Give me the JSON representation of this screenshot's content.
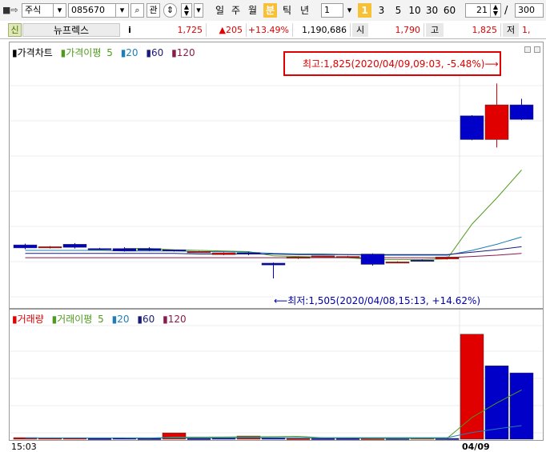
{
  "toolbar": {
    "market": "주식",
    "code": "085670",
    "btn_gwan": "관",
    "periods": [
      "일",
      "주",
      "월",
      "분",
      "틱",
      "년"
    ],
    "active_period": "분",
    "interval_value": "1",
    "presets": [
      "1",
      "3",
      "5",
      "10",
      "30",
      "60"
    ],
    "count_value": "21",
    "slash": "/",
    "total_value": "300"
  },
  "quote": {
    "badge": "신",
    "name": "뉴프렉스",
    "info_btn": "i",
    "price": "1,725",
    "change": "▲205",
    "change_rate": "+13.49%",
    "volume": "1,190,686",
    "open_label": "시",
    "open": "1,790",
    "high_label": "고",
    "high": "1,825",
    "low_label": "저",
    "low_partial": "1,"
  },
  "price_pane": {
    "legend": {
      "title": "가격차트",
      "ma_label": "가격이평",
      "ma1": "5",
      "ma2": "20",
      "ma3": "60",
      "ma4": "120"
    },
    "high_annotation": "최고:1,825(2020/04/09,09:03, -5.48%)⟶",
    "low_annotation": "⟵최저:1,505(2020/04/08,15:13, +14.62%)"
  },
  "volume_pane": {
    "legend": {
      "title": "거래량",
      "ma_label": "거래이평",
      "ma1": "5",
      "ma2": "20",
      "ma3": "60",
      "ma4": "120"
    }
  },
  "xaxis": {
    "left_label": "15:03",
    "right_label": "04/09"
  },
  "colors": {
    "up": "#e00000",
    "down": "#0000c8",
    "ma5": "#4f9a1e",
    "ma20": "#1e7fb8",
    "ma60": "#1a1a7a",
    "ma120": "#8a1a4a",
    "active_tab": "#f7c137",
    "annotation_box": "#e00000"
  },
  "chart_data": [
    {
      "type": "candlestick",
      "title": "가격차트",
      "ylim": [
        1480,
        1840
      ],
      "candles": [
        {
          "o": 1560,
          "c": 1555,
          "h": 1562,
          "l": 1553
        },
        {
          "o": 1555,
          "c": 1557,
          "h": 1558,
          "l": 1554
        },
        {
          "o": 1561,
          "c": 1556,
          "h": 1563,
          "l": 1554
        },
        {
          "o": 1554,
          "c": 1553,
          "h": 1555,
          "l": 1552
        },
        {
          "o": 1554,
          "c": 1550,
          "h": 1556,
          "l": 1549
        },
        {
          "o": 1554,
          "c": 1551,
          "h": 1556,
          "l": 1550
        },
        {
          "o": 1552,
          "c": 1551,
          "h": 1552,
          "l": 1549
        },
        {
          "o": 1549,
          "c": 1549,
          "h": 1550,
          "l": 1548
        },
        {
          "o": 1544,
          "c": 1547,
          "h": 1548,
          "l": 1543
        },
        {
          "o": 1547,
          "c": 1545,
          "h": 1548,
          "l": 1543
        },
        {
          "o": 1530,
          "c": 1527,
          "h": 1531,
          "l": 1505
        },
        {
          "o": 1539,
          "c": 1540,
          "h": 1541,
          "l": 1537
        },
        {
          "o": 1541,
          "c": 1542,
          "h": 1542,
          "l": 1540
        },
        {
          "o": 1541,
          "c": 1541,
          "h": 1542,
          "l": 1540
        },
        {
          "o": 1545,
          "c": 1528,
          "h": 1546,
          "l": 1526
        },
        {
          "o": 1531,
          "c": 1532,
          "h": 1533,
          "l": 1530
        },
        {
          "o": 1535,
          "c": 1534,
          "h": 1536,
          "l": 1533
        },
        {
          "o": 1537,
          "c": 1540,
          "h": 1541,
          "l": 1536
        },
        {
          "o": 1772,
          "c": 1733,
          "h": 1773,
          "l": 1732
        },
        {
          "o": 1733,
          "c": 1790,
          "h": 1825,
          "l": 1720
        },
        {
          "o": 1790,
          "c": 1766,
          "h": 1800,
          "l": 1765
        }
      ],
      "ma5": [
        null,
        null,
        null,
        null,
        1554,
        1554,
        1552,
        1551,
        1550,
        1549,
        1542,
        1541,
        1540,
        1539,
        1536,
        1536,
        1536,
        1537,
        1594,
        1637,
        1683
      ],
      "ma20": [
        1551,
        1551,
        1551,
        1551,
        1550,
        1550,
        1550,
        1549,
        1549,
        1548,
        1546,
        1545,
        1545,
        1544,
        1543,
        1543,
        1543,
        1543,
        1551,
        1561,
        1573
      ],
      "ma60": [
        1546,
        1546,
        1546,
        1546,
        1546,
        1546,
        1546,
        1545,
        1545,
        1545,
        1545,
        1544,
        1544,
        1544,
        1544,
        1544,
        1544,
        1544,
        1548,
        1552,
        1557
      ],
      "ma120": [
        1539,
        1539,
        1539,
        1539,
        1539,
        1539,
        1539,
        1539,
        1539,
        1539,
        1539,
        1539,
        1539,
        1539,
        1539,
        1539,
        1539,
        1539,
        1541,
        1543,
        1546
      ]
    },
    {
      "type": "bar",
      "title": "거래량",
      "ylim": [
        0,
        150
      ],
      "values": [
        2,
        1.5,
        1.5,
        1,
        1.5,
        1,
        8,
        1,
        1.5,
        4,
        1.5,
        1,
        1,
        1,
        1,
        1,
        1.5,
        1,
        133,
        93,
        84
      ],
      "up": [
        true,
        true,
        true,
        false,
        false,
        false,
        true,
        false,
        false,
        true,
        false,
        true,
        false,
        false,
        true,
        false,
        true,
        false,
        true,
        false,
        false
      ],
      "ma5": [
        null,
        null,
        null,
        null,
        1.5,
        1.3,
        2.6,
        2.6,
        2.8,
        3.1,
        3.2,
        3.6,
        1.8,
        1.7,
        1.1,
        1,
        1.1,
        1.1,
        27.5,
        45.9,
        62.4
      ],
      "ma20": [
        1.7,
        1.7,
        1.7,
        1.7,
        1.7,
        1.7,
        1.8,
        1.8,
        1.8,
        1.9,
        1.9,
        1.9,
        1.9,
        1.9,
        1.9,
        1.9,
        1.9,
        1.9,
        8.5,
        13.1,
        17.2
      ]
    }
  ]
}
